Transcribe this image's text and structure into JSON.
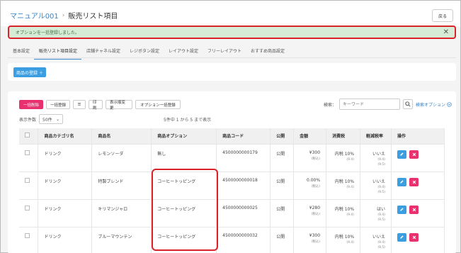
{
  "breadcrumb": {
    "parent": "マニュアル001",
    "current": "販売リスト項目"
  },
  "back_label": "戻る",
  "alert": {
    "message": "オプションを一括登録しました。"
  },
  "tabs": [
    {
      "label": "基本設定"
    },
    {
      "label": "販売リスト項目設定",
      "active": true
    },
    {
      "label": "店舗チャネル設定"
    },
    {
      "label": "レジボタン設定"
    },
    {
      "label": "レイアウト設定"
    },
    {
      "label": "フリーレイアウト"
    },
    {
      "label": "おすすめ商品設定"
    }
  ],
  "register_product_label": "商品の登録 ＋",
  "toolbar": {
    "bulk_delete": "一括削除",
    "bulk_register": "一括登録",
    "list_icon": "☰",
    "print": "印刷",
    "reorder": "表示順変更",
    "option_bulk_register": "オプション一括登録"
  },
  "search": {
    "label": "検索：",
    "placeholder": "キーワード",
    "options_link": "検索オプション"
  },
  "display_count": {
    "label": "表示件数",
    "value": "50件"
  },
  "result_text": "5件中 1 から 5 まで表示",
  "table": {
    "headers": [
      "",
      "商品カテゴリ名",
      "商品名",
      "商品オプション",
      "商品コード",
      "公開",
      "金額",
      "消費税",
      "軽減税率",
      "操作"
    ],
    "rows": [
      {
        "category": "ドリンク",
        "name": "レモンソーダ",
        "option": "無し",
        "code": "4500000000179",
        "public": "公開",
        "price": "¥300",
        "price_sub": "(税込)",
        "tax": "内税 10%",
        "tax_sub": "(9.4)",
        "reduced": "いいえ",
        "reduced_sub1": "(9.4)",
        "reduced_sub2": "(9.5)"
      },
      {
        "category": "ドリンク",
        "name": "特製ブレンド",
        "option": "コーヒートッピング",
        "code": "4500000000018",
        "public": "公開",
        "price": "0.00%",
        "price_sub": "(税込)",
        "tax": "内税 10%",
        "tax_sub": "(9.4)",
        "reduced": "いいえ",
        "reduced_sub1": "(9.4)",
        "reduced_sub2": "(9.5)"
      },
      {
        "category": "ドリンク",
        "name": "キリマンジャロ",
        "option": "コーヒートッピング",
        "code": "4500000000025",
        "public": "公開",
        "price": "¥280",
        "price_sub": "(税込)",
        "tax": "内税 10%",
        "tax_sub": "(9.4)",
        "reduced": "はい",
        "reduced_sub1": "(9.4)",
        "reduced_sub2": "(9.5)"
      },
      {
        "category": "ドリンク",
        "name": "ブルーマウンテン",
        "option": "コーヒートッピング",
        "code": "4500000000032",
        "public": "公開",
        "price": "¥300",
        "price_sub": "(税込)",
        "tax": "内税 10%",
        "tax_sub": "(9.4)",
        "reduced": "いいえ",
        "reduced_sub1": "(9.4)",
        "reduced_sub2": "(9.5)"
      }
    ]
  },
  "colors": {
    "accent": "#3a9ee0",
    "danger": "#e8316e",
    "alert_bg": "#d6ecd6",
    "highlight": "#d9222a"
  }
}
